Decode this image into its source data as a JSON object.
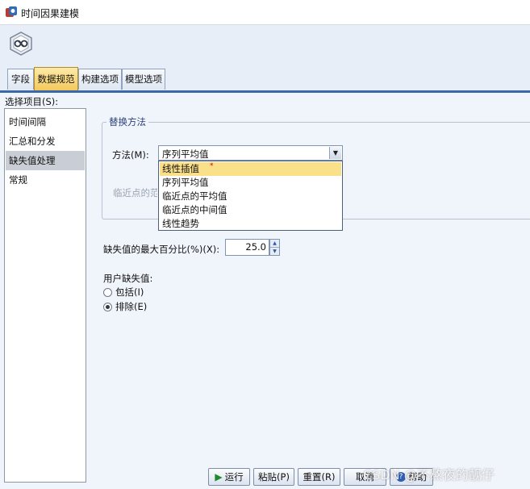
{
  "window": {
    "title": "时间因果建模",
    "app_icon": "spss-modeler-icon",
    "node_icon": "time-causal-node-icon"
  },
  "tabs": [
    {
      "label": "字段",
      "active": false
    },
    {
      "label": "数据规范",
      "active": true
    },
    {
      "label": "构建选项",
      "active": false
    },
    {
      "label": "模型选项",
      "active": false
    }
  ],
  "sidebar": {
    "label": "选择项目(S):",
    "items": [
      {
        "label": "时间间隔",
        "selected": false
      },
      {
        "label": "汇总和分发",
        "selected": false
      },
      {
        "label": "缺失值处理",
        "selected": true
      },
      {
        "label": "常规",
        "selected": false
      }
    ]
  },
  "replace_group": {
    "title": "替换方法",
    "method_label": "方法(M):",
    "method_value": "序列平均值",
    "neighbor_label": "临近点的范",
    "options": [
      "线性插值",
      "序列平均值",
      "临近点的平均值",
      "临近点的中间值",
      "线性趋势"
    ],
    "highlighted": "线性插值"
  },
  "max_missing": {
    "label": "缺失值的最大百分比(%)(X):",
    "value": "25.0"
  },
  "user_missing": {
    "label": "用户缺失值:",
    "options": [
      {
        "label": "包括(I)",
        "checked": false
      },
      {
        "label": "排除(E)",
        "checked": true
      }
    ]
  },
  "buttons": {
    "run": "运行",
    "paste": "粘贴(P)",
    "reset": "重置(R)",
    "cancel": "取消",
    "help": "帮助"
  },
  "watermark": "CSDN @不熬夜的靓仔",
  "colors": {
    "active_tab": "#f4c85a",
    "highlight": "#fbe08a",
    "tab_rule": "#3a68a8",
    "selected_item": "#c9ced6"
  }
}
